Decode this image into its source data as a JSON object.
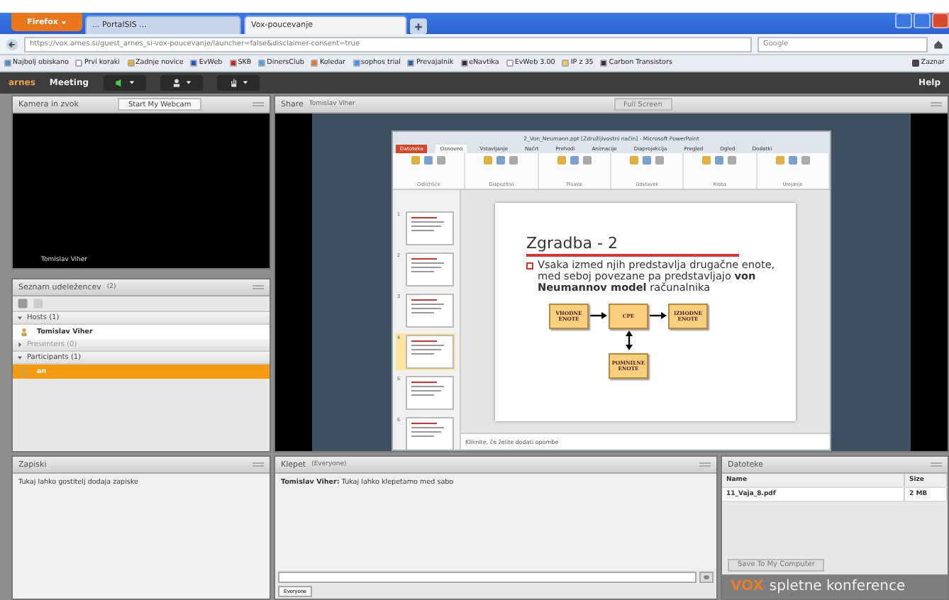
{
  "browser": {
    "menu_button": "Firefox",
    "tabs": [
      {
        "label": "... PortalSIS ...",
        "selected": false
      },
      {
        "label": "Vox-poucevanje",
        "selected": true
      }
    ],
    "url": "https://vox.arnes.si/guest_arnes_si-vox-poucevanje/launcher=false&disclaimer-consent=true",
    "search": {
      "placeholder": "Google"
    },
    "bookmarks": [
      "Najbolj obiskano",
      "Prvi koraki",
      "Zadnje novice",
      "EvWeb",
      "SKB",
      "DinersClub",
      "Koledar",
      "sophos trial",
      "Prevajalnik",
      "eNavtika",
      "EvWeb 3.00",
      "IP z 35",
      "Carbon Transistors"
    ],
    "bookmarks_menu": "Zaznar"
  },
  "app": {
    "logo": "arnes",
    "menu": "Meeting",
    "help": "Help"
  },
  "camera": {
    "title": "Kamera in zvok",
    "button": "Start My Webcam",
    "video_label": "Tomislav Viher"
  },
  "attendees": {
    "title": "Seznam udeležencev",
    "count": "(2)",
    "groups": [
      {
        "label": "Hosts (1)",
        "expanded": true,
        "members": [
          {
            "name": "Tomislav Viher",
            "selected": false
          }
        ]
      },
      {
        "label": "Presenters (0)",
        "expanded": false
      },
      {
        "label": "Participants (1)",
        "expanded": true,
        "members": [
          {
            "name": "an",
            "selected": true
          }
        ]
      }
    ]
  },
  "share": {
    "title": "Share",
    "presenter": "Tomislav Viher",
    "full_screen": "Full Screen"
  },
  "powerpoint": {
    "title": "2_Von_Neumann.ppt [Združljivostni način] - Microsoft PowerPoint",
    "tabs": [
      {
        "label": "Datoteka",
        "kind": "file",
        "selected": false
      },
      {
        "label": "Osnovno",
        "kind": "tab",
        "selected": true
      },
      {
        "label": "Vstavljanje",
        "kind": "tab",
        "selected": false
      },
      {
        "label": "Načrt",
        "kind": "tab",
        "selected": false
      },
      {
        "label": "Prehodi",
        "kind": "tab",
        "selected": false
      },
      {
        "label": "Animacije",
        "kind": "tab",
        "selected": false
      },
      {
        "label": "Diaprojekcija",
        "kind": "tab",
        "selected": false
      },
      {
        "label": "Pregled",
        "kind": "tab",
        "selected": false
      },
      {
        "label": "Ogled",
        "kind": "tab",
        "selected": false
      },
      {
        "label": "Dodatki",
        "kind": "tab",
        "selected": false
      }
    ],
    "groups": [
      "Odložišče",
      "Diapozitivi",
      "Pisava",
      "Odstavek",
      "Risba",
      "Urejanje"
    ],
    "thumbnails": [
      {
        "number": "1",
        "selected": false
      },
      {
        "number": "2",
        "selected": false
      },
      {
        "number": "3",
        "selected": false
      },
      {
        "number": "4",
        "selected": true
      },
      {
        "number": "5",
        "selected": false
      },
      {
        "number": "6",
        "selected": false
      }
    ],
    "slide": {
      "title": "Zgradba - 2",
      "bullet": "Vsaka izmed njih predstavlja drugačne enote, med seboj povezane pa predstavljajo **von Neumannov model** računalnika",
      "diagram": {
        "input": "VHODNE ENOTE",
        "cpu": "CPE",
        "output": "IZHODNE ENOTE",
        "memory": "POMNILNE ENOTE"
      }
    },
    "notes": "Kliknite, če želite dodati opombe"
  },
  "notes": {
    "title": "Zapiski",
    "text": "Tukaj lahko gostitelj dodaja zapiske"
  },
  "chat": {
    "title": "Klepet",
    "scope": "(Everyone)",
    "messages": [
      {
        "author": "Tomislav Viher:",
        "text": "Tukaj lahko klepetamo med sabo"
      }
    ],
    "tab": "Everyone"
  },
  "files": {
    "title": "Datoteke",
    "columns": [
      "Name",
      "Size"
    ],
    "rows": [
      {
        "name": "11_Vaja_8.pdf",
        "size": "2 MB"
      }
    ],
    "button": "Save To My Computer",
    "brand": "VOX",
    "branding": "spletne konference"
  }
}
